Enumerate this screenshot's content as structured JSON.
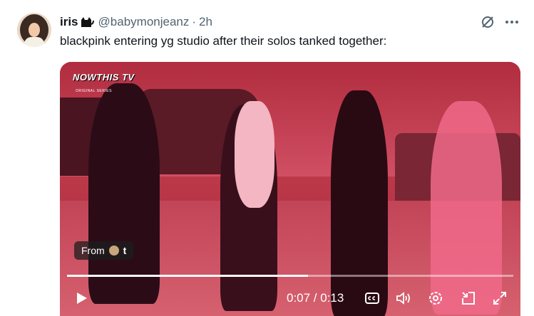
{
  "tweet": {
    "display_name": "iris",
    "handle": "@babymonjeanz",
    "separator": "·",
    "time": "2h",
    "text": "blackpink entering yg studio after their solos tanked together:"
  },
  "video": {
    "watermark": "NOWTHIS TV",
    "watermark_sub": "ORIGINAL SERIES",
    "from_label": "From",
    "from_source": "t",
    "progress": 0.54,
    "time_readout": "0:07 / 0:13"
  },
  "icons": {
    "grok": "grok-icon",
    "more": "more-icon",
    "play": "play-icon",
    "cc": "cc-icon",
    "volume": "volume-icon",
    "settings": "gear-icon",
    "pip": "pip-icon",
    "fullscreen": "expand-icon"
  }
}
